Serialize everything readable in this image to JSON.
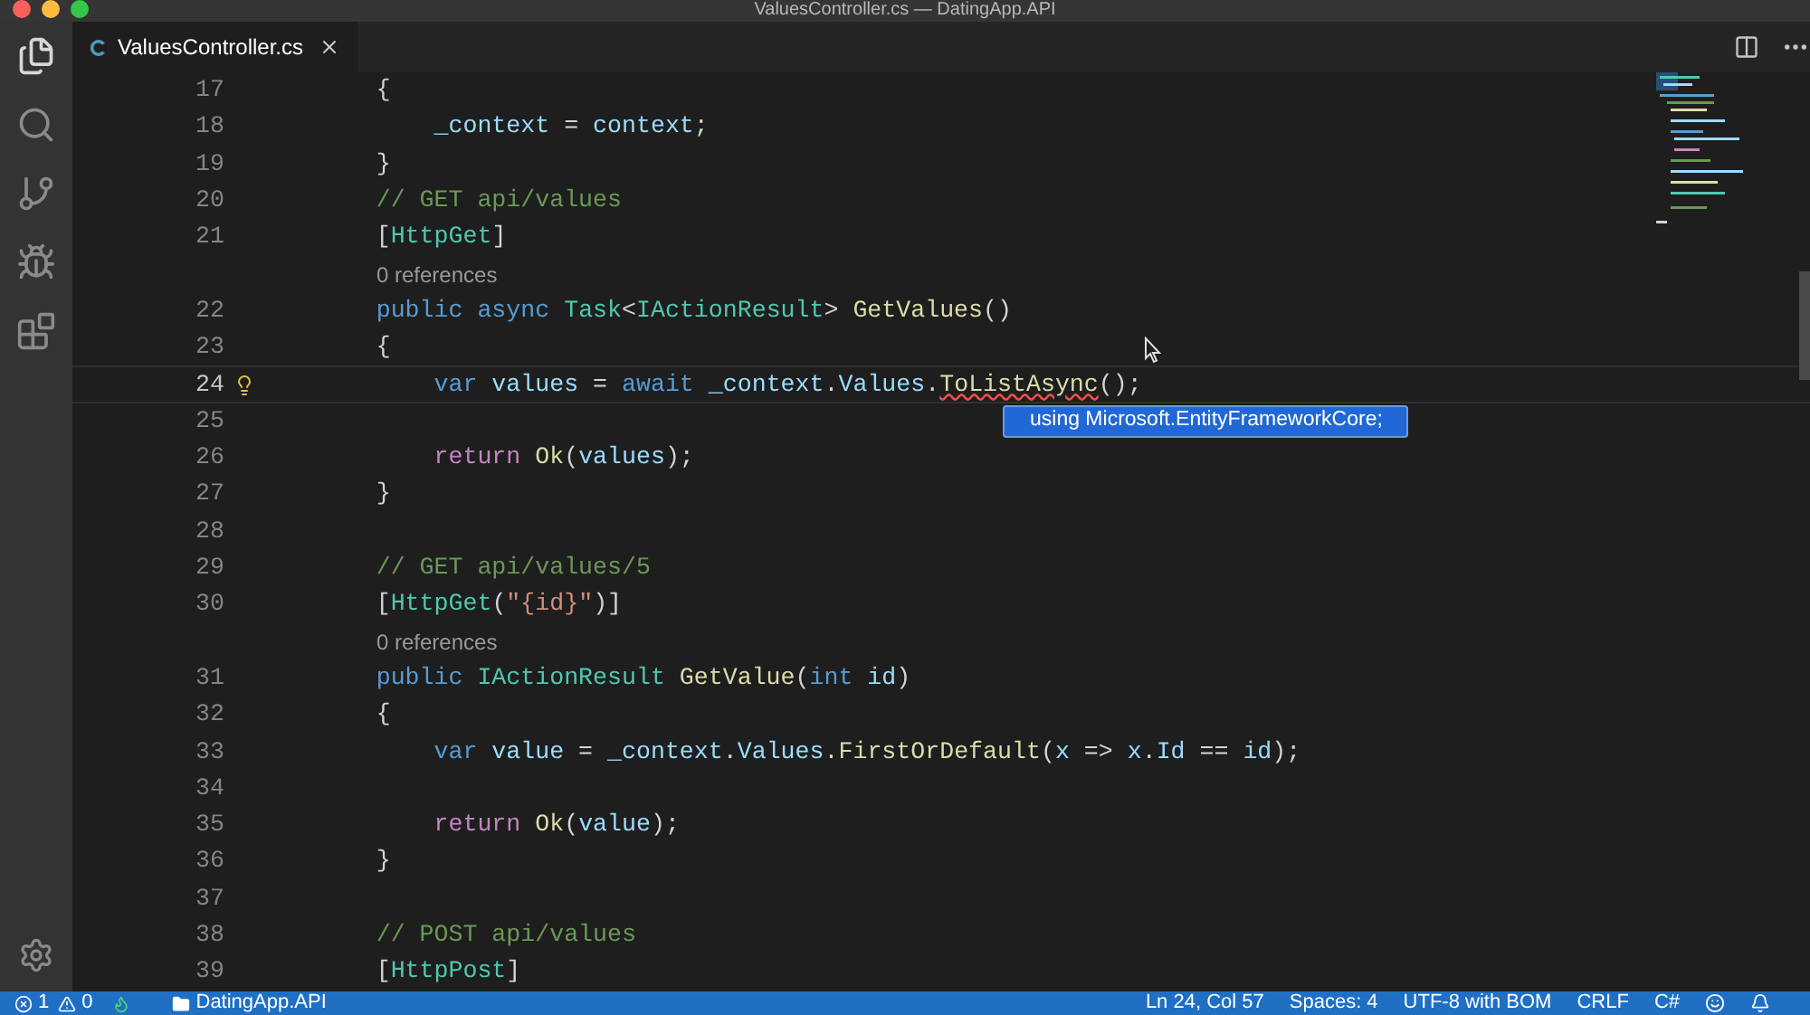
{
  "window": {
    "title": "ValuesController.cs — DatingApp.API"
  },
  "tabs": [
    {
      "label": "ValuesController.cs",
      "selected": true
    }
  ],
  "lines": [
    {
      "kind": "code",
      "number": "17",
      "current": false,
      "lightbulb": false,
      "tokens": [
        {
          "text": "        {",
          "kind": "plain"
        }
      ]
    },
    {
      "kind": "code",
      "number": "18",
      "current": false,
      "lightbulb": false,
      "tokens": [
        {
          "text": "            _context",
          "kind": "var"
        },
        {
          "text": " = ",
          "kind": "plain"
        },
        {
          "text": "context",
          "kind": "var"
        },
        {
          "text": ";",
          "kind": "plain"
        }
      ]
    },
    {
      "kind": "code",
      "number": "19",
      "current": false,
      "lightbulb": false,
      "tokens": [
        {
          "text": "        }",
          "kind": "plain"
        }
      ]
    },
    {
      "kind": "code",
      "number": "20",
      "current": false,
      "lightbulb": false,
      "tokens": [
        {
          "text": "        // GET api/values",
          "kind": "comment"
        }
      ]
    },
    {
      "kind": "code",
      "number": "21",
      "current": false,
      "lightbulb": false,
      "tokens": [
        {
          "text": "        [",
          "kind": "plain"
        },
        {
          "text": "HttpGet",
          "kind": "type"
        },
        {
          "text": "]",
          "kind": "plain"
        }
      ]
    },
    {
      "kind": "lens",
      "text": "0 references"
    },
    {
      "kind": "code",
      "number": "22",
      "current": false,
      "lightbulb": false,
      "tokens": [
        {
          "text": "        public ",
          "kind": "keyword"
        },
        {
          "text": "async ",
          "kind": "keyword"
        },
        {
          "text": "Task",
          "kind": "type"
        },
        {
          "text": "<",
          "kind": "plain"
        },
        {
          "text": "IActionResult",
          "kind": "type"
        },
        {
          "text": "> ",
          "kind": "plain"
        },
        {
          "text": "GetValues",
          "kind": "func"
        },
        {
          "text": "()",
          "kind": "plain"
        }
      ]
    },
    {
      "kind": "code",
      "number": "23",
      "current": false,
      "lightbulb": false,
      "tokens": [
        {
          "text": "        {",
          "kind": "plain"
        }
      ]
    },
    {
      "kind": "code",
      "number": "24",
      "current": true,
      "lightbulb": true,
      "tokens": [
        {
          "text": "            var ",
          "kind": "keyword"
        },
        {
          "text": "values",
          "kind": "var"
        },
        {
          "text": " = ",
          "kind": "plain"
        },
        {
          "text": "await ",
          "kind": "keyword"
        },
        {
          "text": "_context",
          "kind": "var"
        },
        {
          "text": ".",
          "kind": "plain"
        },
        {
          "text": "Values",
          "kind": "var"
        },
        {
          "text": ".",
          "kind": "plain"
        },
        {
          "text": "ToListAsync",
          "kind": "error"
        },
        {
          "text": "();",
          "kind": "plain"
        }
      ]
    },
    {
      "kind": "code",
      "number": "25",
      "current": false,
      "lightbulb": false
    },
    {
      "kind": "code",
      "number": "26",
      "current": false,
      "lightbulb": false,
      "tokens": [
        {
          "text": "            return ",
          "kind": "control"
        },
        {
          "text": "Ok",
          "kind": "func"
        },
        {
          "text": "(",
          "kind": "plain"
        },
        {
          "text": "values",
          "kind": "var"
        },
        {
          "text": ");",
          "kind": "plain"
        }
      ]
    },
    {
      "kind": "code",
      "number": "27",
      "current": false,
      "lightbulb": false,
      "tokens": [
        {
          "text": "        }",
          "kind": "plain"
        }
      ]
    },
    {
      "kind": "code",
      "number": "28",
      "current": false,
      "lightbulb": false
    },
    {
      "kind": "code",
      "number": "29",
      "current": false,
      "lightbulb": false,
      "tokens": [
        {
          "text": "        // GET api/values/5",
          "kind": "comment"
        }
      ]
    },
    {
      "kind": "code",
      "number": "30",
      "current": false,
      "lightbulb": false,
      "tokens": [
        {
          "text": "        [",
          "kind": "plain"
        },
        {
          "text": "HttpGet",
          "kind": "type"
        },
        {
          "text": "(",
          "kind": "plain"
        },
        {
          "text": "\"{id}\"",
          "kind": "string"
        },
        {
          "text": ")]",
          "kind": "plain"
        }
      ]
    },
    {
      "kind": "lens",
      "text": "0 references"
    },
    {
      "kind": "code",
      "number": "31",
      "current": false,
      "lightbulb": false,
      "tokens": [
        {
          "text": "        public ",
          "kind": "keyword"
        },
        {
          "text": "IActionResult",
          "kind": "type"
        },
        {
          "text": " GetValue",
          "kind": "func"
        },
        {
          "text": "(",
          "kind": "plain"
        },
        {
          "text": "int ",
          "kind": "keyword"
        },
        {
          "text": "id",
          "kind": "var"
        },
        {
          "text": ")",
          "kind": "plain"
        }
      ]
    },
    {
      "kind": "code",
      "number": "32",
      "current": false,
      "lightbulb": false,
      "tokens": [
        {
          "text": "        {",
          "kind": "plain"
        }
      ]
    },
    {
      "kind": "code",
      "number": "33",
      "current": false,
      "lightbulb": false,
      "tokens": [
        {
          "text": "            var ",
          "kind": "keyword"
        },
        {
          "text": "value",
          "kind": "var"
        },
        {
          "text": " = ",
          "kind": "plain"
        },
        {
          "text": "_context",
          "kind": "var"
        },
        {
          "text": ".",
          "kind": "plain"
        },
        {
          "text": "Values",
          "kind": "var"
        },
        {
          "text": ".",
          "kind": "plain"
        },
        {
          "text": "FirstOrDefault",
          "kind": "func"
        },
        {
          "text": "(",
          "kind": "plain"
        },
        {
          "text": "x",
          "kind": "var"
        },
        {
          "text": " => ",
          "kind": "plain"
        },
        {
          "text": "x",
          "kind": "var"
        },
        {
          "text": ".",
          "kind": "plain"
        },
        {
          "text": "Id",
          "kind": "var"
        },
        {
          "text": " == ",
          "kind": "plain"
        },
        {
          "text": "id",
          "kind": "var"
        },
        {
          "text": ");",
          "kind": "plain"
        }
      ]
    },
    {
      "kind": "code",
      "number": "34",
      "current": false,
      "lightbulb": false
    },
    {
      "kind": "code",
      "number": "35",
      "current": false,
      "lightbulb": false,
      "tokens": [
        {
          "text": "            return ",
          "kind": "control"
        },
        {
          "text": "Ok",
          "kind": "func"
        },
        {
          "text": "(",
          "kind": "plain"
        },
        {
          "text": "value",
          "kind": "var"
        },
        {
          "text": ");",
          "kind": "plain"
        }
      ]
    },
    {
      "kind": "code",
      "number": "36",
      "current": false,
      "lightbulb": false,
      "tokens": [
        {
          "text": "        }",
          "kind": "plain"
        }
      ]
    },
    {
      "kind": "code",
      "number": "37",
      "current": false,
      "lightbulb": false
    },
    {
      "kind": "code",
      "number": "38",
      "current": false,
      "lightbulb": false,
      "tokens": [
        {
          "text": "        // POST api/values",
          "kind": "comment"
        }
      ]
    },
    {
      "kind": "code",
      "number": "39",
      "current": false,
      "lightbulb": false,
      "tokens": [
        {
          "text": "        [",
          "kind": "plain"
        },
        {
          "text": "HttpPost",
          "kind": "type"
        },
        {
          "text": "]",
          "kind": "plain"
        }
      ]
    }
  ],
  "quick_fix": {
    "text": "using Microsoft.EntityFrameworkCore;"
  },
  "status_bar": {
    "errors": "1",
    "warnings": "0",
    "folder": "DatingApp.API",
    "position": "Ln 24, Col 57",
    "indent": "Spaces: 4",
    "encoding": "UTF-8 with BOM",
    "line_ending": "CRLF",
    "language": "C#"
  }
}
